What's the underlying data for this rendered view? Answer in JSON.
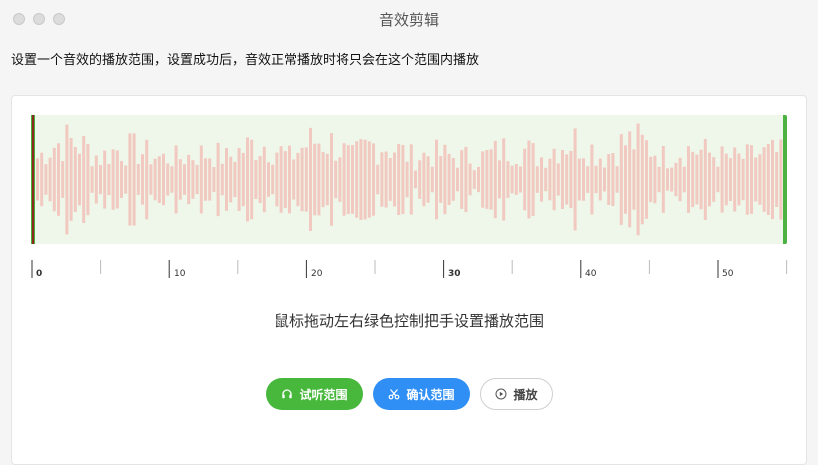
{
  "window": {
    "title": "音效剪辑"
  },
  "description": "设置一个音效的播放范围，设置成功后，音效正常播放时将只会在这个范围内播放",
  "hint": "鼠标拖动左右绿色控制把手设置播放范围",
  "ruler": {
    "labels": [
      "0",
      "10",
      "20",
      "30",
      "40",
      "50"
    ],
    "bold_labels": [
      "0",
      "30"
    ]
  },
  "buttons": {
    "preview": "试听范围",
    "confirm": "确认范围",
    "play": "播放"
  },
  "icons": {
    "preview": "headphones-icon",
    "confirm": "scissors-icon",
    "play": "play-circle-icon"
  },
  "colors": {
    "waveform_bar": "#f2c9c0",
    "range_background": "#eef7ea",
    "handle_green": "#4cb342",
    "preview_button": "#47b83c",
    "confirm_button": "#2f8ff5"
  }
}
